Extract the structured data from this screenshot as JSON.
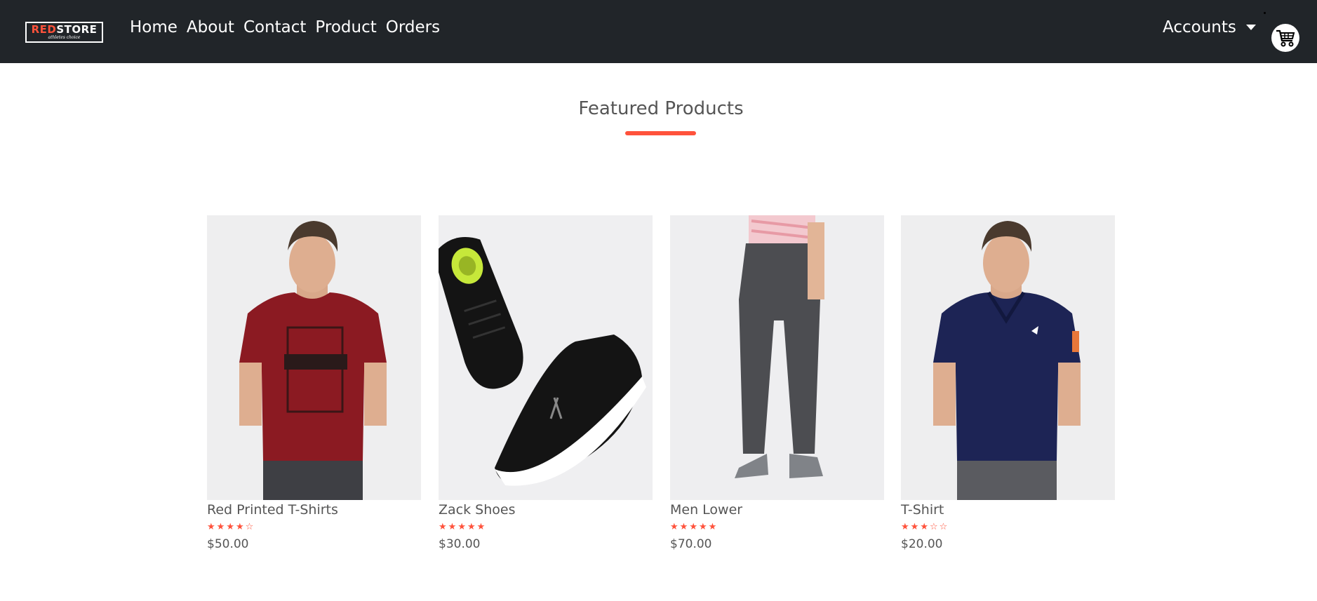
{
  "navbar": {
    "logo": {
      "part1": "RED",
      "part2": "STORE",
      "tagline": "athletes choice"
    },
    "links": [
      "Home",
      "About",
      "Contact",
      "Product",
      "Orders"
    ],
    "accounts_label": "Accounts"
  },
  "section": {
    "title": "Featured Products"
  },
  "products": [
    {
      "name": "Red Printed T-Shirts",
      "rating": 4,
      "price": "$50.00",
      "image": "red-tshirt-model"
    },
    {
      "name": "Zack Shoes",
      "rating": 5,
      "price": "$30.00",
      "image": "black-shoes"
    },
    {
      "name": "Men Lower",
      "rating": 5,
      "price": "$70.00",
      "image": "grey-joggers"
    },
    {
      "name": "T-Shirt",
      "rating": 3,
      "price": "$20.00",
      "image": "navy-polo-model"
    }
  ],
  "colors": {
    "accent": "#ff523b",
    "navbar": "#212529",
    "card_bg": "#f1f1f3"
  },
  "icons": {
    "cart": "cart-icon",
    "caret": "caret-down-icon",
    "star": "star-icon"
  }
}
